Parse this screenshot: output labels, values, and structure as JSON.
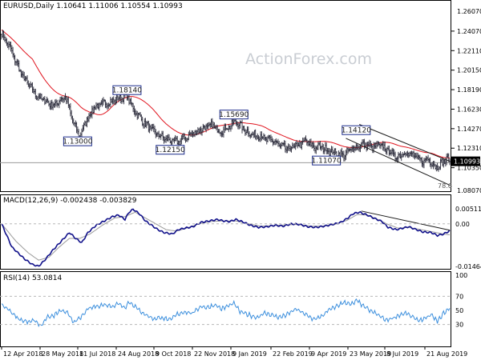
{
  "watermark": "ActionForex.com",
  "colors": {
    "candle": "#2a2a3a",
    "ma": "#e0141e",
    "macd": "#10108a",
    "signal": "#9a9a9a",
    "rsi": "#3c8fdd",
    "channel": "#1a1a1a",
    "grid": "#b8b8b8",
    "label_bg": "#1a2a8a",
    "price_bg": "#000000"
  },
  "chart_data": [
    {
      "type": "candlestick",
      "title": "EURUSD,Daily 1.10641 1.11006 1.10554 1.10993",
      "ylim": [
        1.0807,
        1.2607
      ],
      "yticks": [
        1.2607,
        1.2407,
        1.2211,
        1.2015,
        1.1819,
        1.1623,
        1.1427,
        1.1231,
        1.1035,
        1.0807
      ],
      "ytick_labels": [
        "1.26070",
        "1.24070",
        "1.22110",
        "1.20150",
        "1.18190",
        "1.16230",
        "1.14270",
        "1.12310",
        "1.10350",
        "1.08070"
      ],
      "last_price": 1.10993,
      "last_price_label": "1.10993",
      "fib_label": "78.6",
      "xtick_labels": [
        "12 Apr 2018",
        "28 May 2018",
        "11 Jul 2018",
        "24 Aug 2018",
        "9 Oct 2018",
        "22 Nov 2018",
        "9 Jan 2019",
        "22 Feb 2019",
        "9 Apr 2019",
        "23 May 2019",
        "8 Jul 2019",
        "21 Aug 2019"
      ],
      "anchors": [
        [
          0,
          1.238
        ],
        [
          8,
          1.224
        ],
        [
          20,
          1.196
        ],
        [
          34,
          1.176
        ],
        [
          50,
          1.166
        ],
        [
          62,
          1.175
        ],
        [
          66,
          1.162
        ],
        [
          70,
          1.148
        ],
        [
          76,
          1.135
        ],
        [
          82,
          1.15
        ],
        [
          90,
          1.164
        ],
        [
          100,
          1.168
        ],
        [
          112,
          1.172
        ],
        [
          122,
          1.176
        ],
        [
          128,
          1.163
        ],
        [
          135,
          1.153
        ],
        [
          142,
          1.145
        ],
        [
          150,
          1.138
        ],
        [
          160,
          1.132
        ],
        [
          170,
          1.129
        ],
        [
          180,
          1.134
        ],
        [
          186,
          1.138
        ],
        [
          196,
          1.143
        ],
        [
          205,
          1.146
        ],
        [
          212,
          1.14
        ],
        [
          220,
          1.144
        ],
        [
          228,
          1.15
        ],
        [
          238,
          1.14
        ],
        [
          246,
          1.136
        ],
        [
          252,
          1.136
        ],
        [
          258,
          1.131
        ],
        [
          264,
          1.131
        ],
        [
          270,
          1.126
        ],
        [
          278,
          1.122
        ],
        [
          288,
          1.126
        ],
        [
          296,
          1.13
        ],
        [
          304,
          1.124
        ],
        [
          312,
          1.124
        ],
        [
          320,
          1.12
        ],
        [
          332,
          1.116
        ],
        [
          342,
          1.123
        ],
        [
          352,
          1.127
        ],
        [
          360,
          1.124
        ],
        [
          368,
          1.126
        ],
        [
          376,
          1.121
        ],
        [
          384,
          1.114
        ],
        [
          392,
          1.119
        ],
        [
          400,
          1.116
        ],
        [
          408,
          1.11
        ],
        [
          416,
          1.112
        ],
        [
          422,
          1.104
        ],
        [
          428,
          1.108
        ],
        [
          434,
          1.113
        ],
        [
          436,
          1.11
        ]
      ],
      "annotations": [
        {
          "label": "1.18140",
          "value": 1.1814,
          "bar": 122
        },
        {
          "label": "1.13000",
          "value": 1.13,
          "bar": 74
        },
        {
          "label": "1.12150",
          "value": 1.1215,
          "bar": 164
        },
        {
          "label": "1.15690",
          "value": 1.1569,
          "bar": 226
        },
        {
          "label": "1.11070",
          "value": 1.1107,
          "bar": 316
        },
        {
          "label": "1.14120",
          "value": 1.1412,
          "bar": 345
        }
      ],
      "channel": {
        "upper": [
          [
            348,
            1.147
          ],
          [
            436,
            1.11
          ]
        ],
        "lower": [
          [
            335,
            1.133
          ],
          [
            436,
            1.086
          ]
        ]
      },
      "hline": 1.1085
    },
    {
      "type": "line",
      "title": "MACD(12,26,9) -0.002438 -0.003829",
      "ylim": [
        -0.0152,
        0.006
      ],
      "yticks": [
        0.005114,
        0.0,
        -0.014647
      ],
      "ytick_labels": [
        "0.005114",
        "0.00",
        "-0.014647"
      ],
      "series": [
        {
          "anchors": [
            [
              0,
              0.0
            ],
            [
              10,
              -0.008
            ],
            [
              22,
              -0.012
            ],
            [
              30,
              -0.014
            ],
            [
              36,
              -0.0146
            ],
            [
              42,
              -0.0125
            ],
            [
              50,
              -0.009
            ],
            [
              58,
              -0.006
            ],
            [
              66,
              -0.003
            ],
            [
              72,
              -0.005
            ],
            [
              78,
              -0.0065
            ],
            [
              84,
              -0.003
            ],
            [
              92,
              -0.0005
            ],
            [
              100,
              0.001
            ],
            [
              108,
              0.0025
            ],
            [
              114,
              0.003
            ],
            [
              120,
              0.0015
            ],
            [
              124,
              0.004
            ],
            [
              128,
              0.005
            ],
            [
              134,
              0.0035
            ],
            [
              140,
              0.001
            ],
            [
              146,
              -0.0005
            ],
            [
              152,
              -0.002
            ],
            [
              158,
              -0.003
            ],
            [
              166,
              -0.0035
            ],
            [
              172,
              -0.002
            ],
            [
              178,
              -0.0015
            ],
            [
              186,
              -0.001
            ],
            [
              194,
              0.0005
            ],
            [
              202,
              0.001
            ],
            [
              210,
              0.0015
            ],
            [
              216,
              0.001
            ],
            [
              222,
              0.0008
            ],
            [
              228,
              0.0015
            ],
            [
              236,
              0.0005
            ],
            [
              242,
              -0.0005
            ],
            [
              250,
              -0.0012
            ],
            [
              258,
              -0.001
            ],
            [
              266,
              -0.0005
            ],
            [
              274,
              -0.0008
            ],
            [
              282,
              0.0
            ],
            [
              290,
              -0.0002
            ],
            [
              298,
              -0.001
            ],
            [
              306,
              -0.0012
            ],
            [
              314,
              -0.0008
            ],
            [
              322,
              -0.0002
            ],
            [
              330,
              0.0005
            ],
            [
              336,
              0.0018
            ],
            [
              342,
              0.0035
            ],
            [
              348,
              0.004
            ],
            [
              356,
              0.003
            ],
            [
              362,
              0.002
            ],
            [
              370,
              0.0008
            ],
            [
              376,
              -0.0012
            ],
            [
              384,
              -0.002
            ],
            [
              390,
              -0.0015
            ],
            [
              396,
              -0.001
            ],
            [
              402,
              -0.0018
            ],
            [
              410,
              -0.0028
            ],
            [
              418,
              -0.003
            ],
            [
              424,
              -0.004
            ],
            [
              430,
              -0.0035
            ],
            [
              436,
              -0.0024
            ]
          ]
        },
        {
          "anchors": [
            [
              0,
              0.0
            ],
            [
              14,
              -0.006
            ],
            [
              26,
              -0.01
            ],
            [
              36,
              -0.0125
            ],
            [
              46,
              -0.0115
            ],
            [
              56,
              -0.008
            ],
            [
              66,
              -0.005
            ],
            [
              76,
              -0.005
            ],
            [
              86,
              -0.0035
            ],
            [
              98,
              -0.0005
            ],
            [
              110,
              0.002
            ],
            [
              120,
              0.0025
            ],
            [
              130,
              0.004
            ],
            [
              140,
              0.002
            ],
            [
              150,
              0.0
            ],
            [
              160,
              -0.002
            ],
            [
              170,
              -0.0025
            ],
            [
              180,
              -0.0015
            ],
            [
              192,
              0.0
            ],
            [
              204,
              0.0008
            ],
            [
              216,
              0.001
            ],
            [
              228,
              0.001
            ],
            [
              240,
              0.0
            ],
            [
              252,
              -0.0008
            ],
            [
              264,
              -0.0006
            ],
            [
              276,
              -0.0004
            ],
            [
              288,
              -0.0002
            ],
            [
              300,
              -0.0008
            ],
            [
              312,
              -0.0008
            ],
            [
              324,
              -0.0002
            ],
            [
              336,
              0.0012
            ],
            [
              346,
              0.0032
            ],
            [
              356,
              0.003
            ],
            [
              366,
              0.0015
            ],
            [
              376,
              -0.0002
            ],
            [
              386,
              -0.0015
            ],
            [
              396,
              -0.0012
            ],
            [
              408,
              -0.002
            ],
            [
              420,
              -0.0028
            ],
            [
              430,
              -0.0035
            ],
            [
              436,
              -0.0038
            ]
          ]
        }
      ]
    },
    {
      "type": "line",
      "title": "RSI(14) 53.0814",
      "ylim": [
        0,
        100
      ],
      "yticks": [
        100,
        70,
        50,
        30,
        0
      ],
      "ytick_labels": [
        "100",
        "70",
        "50",
        "30",
        "0"
      ],
      "series": [
        {
          "anchors": [
            [
              0,
              58
            ],
            [
              8,
              50
            ],
            [
              16,
              38
            ],
            [
              24,
              34
            ],
            [
              32,
              36
            ],
            [
              38,
              28
            ],
            [
              44,
              40
            ],
            [
              50,
              42
            ],
            [
              58,
              50
            ],
            [
              64,
              46
            ],
            [
              70,
              34
            ],
            [
              76,
              38
            ],
            [
              84,
              52
            ],
            [
              92,
              56
            ],
            [
              100,
              58
            ],
            [
              108,
              56
            ],
            [
              114,
              60
            ],
            [
              120,
              54
            ],
            [
              124,
              62
            ],
            [
              128,
              58
            ],
            [
              134,
              50
            ],
            [
              140,
              44
            ],
            [
              148,
              38
            ],
            [
              156,
              40
            ],
            [
              164,
              36
            ],
            [
              170,
              44
            ],
            [
              178,
              48
            ],
            [
              186,
              46
            ],
            [
              194,
              56
            ],
            [
              200,
              54
            ],
            [
              208,
              58
            ],
            [
              214,
              52
            ],
            [
              220,
              56
            ],
            [
              226,
              60
            ],
            [
              232,
              48
            ],
            [
              240,
              44
            ],
            [
              248,
              40
            ],
            [
              256,
              46
            ],
            [
              262,
              44
            ],
            [
              270,
              40
            ],
            [
              278,
              44
            ],
            [
              286,
              52
            ],
            [
              294,
              46
            ],
            [
              302,
              38
            ],
            [
              310,
              40
            ],
            [
              318,
              50
            ],
            [
              326,
              56
            ],
            [
              334,
              62
            ],
            [
              340,
              58
            ],
            [
              346,
              64
            ],
            [
              352,
              56
            ],
            [
              358,
              50
            ],
            [
              366,
              44
            ],
            [
              374,
              36
            ],
            [
              382,
              40
            ],
            [
              388,
              44
            ],
            [
              394,
              46
            ],
            [
              400,
              40
            ],
            [
              406,
              36
            ],
            [
              412,
              38
            ],
            [
              418,
              44
            ],
            [
              424,
              34
            ],
            [
              430,
              46
            ],
            [
              436,
              53
            ]
          ]
        }
      ]
    }
  ]
}
